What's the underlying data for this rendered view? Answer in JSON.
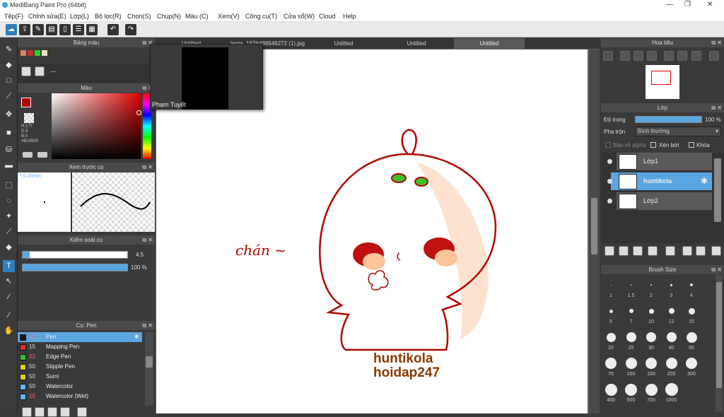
{
  "window": {
    "title": "MediBang Paint Pro (64bit)"
  },
  "menu": [
    "Tệp(F)",
    "Chỉnh sửa(E)",
    "Lớp(L)",
    "Bộ lọc(R)",
    "Chọn(S)",
    "Chụp(N)",
    "Màu (C)",
    "Xem(V)",
    "Công cụ(T)",
    "Cửa sổ(W)",
    "Cloud",
    "Help"
  ],
  "tabs": [
    {
      "label": "Untitled"
    },
    {
      "label": "large_1626488646272 (1).jpg"
    },
    {
      "label": "Untitled"
    },
    {
      "label": "Untitled"
    },
    {
      "label": "Untitled"
    }
  ],
  "popup": {
    "name": "Phạm Tuyết"
  },
  "panels": {
    "palette": {
      "title": "Bảng màu",
      "value": "---"
    },
    "color": {
      "title": "Màu",
      "r": "R:177",
      "g": "G:5",
      "b": "B:0",
      "hex": "#B10500",
      "accent": "#B10500"
    },
    "brush_preview": {
      "title": "Xem trước cọ",
      "size": "0.33mm"
    },
    "brush_control": {
      "title": "Kiểm soát cọ",
      "size": "4.5",
      "opacity": "100 %",
      "opacity_value": 100
    },
    "brushes": {
      "title": "Cọ: Pen",
      "items": [
        {
          "size": "4.5",
          "name": "Pen",
          "color": "#1a1a1a",
          "selected": true
        },
        {
          "size": "15",
          "name": "Mapping Pen",
          "color": "#e03030"
        },
        {
          "size": "22",
          "name": "Edge Pen",
          "color": "#30c030"
        },
        {
          "size": "50",
          "name": "Stipple Pen",
          "color": "#e0d020"
        },
        {
          "size": "50",
          "name": "Sumi",
          "color": "#e0d020"
        },
        {
          "size": "50",
          "name": "Watercolor",
          "color": "#60b8f0"
        },
        {
          "size": "15",
          "name": "Watercolor (Wet)",
          "color": "#60b8f0"
        }
      ]
    },
    "navigator": {
      "title": "Hoa tiêu"
    },
    "layer": {
      "title": "Lớp",
      "opacity_label": "Độ trong",
      "opacity": "100 %",
      "opacity_value": 100,
      "blend_label": "Pha trộn",
      "blend_value": "Bình thường",
      "protect_alpha": "Bảo vệ alpha",
      "clipping": "Xén bớt",
      "lock": "Khóa",
      "layers": [
        {
          "name": "Lớp1",
          "selected": false
        },
        {
          "name": "huntikola",
          "selected": true
        },
        {
          "name": "Lớp2",
          "selected": false
        }
      ]
    },
    "brush_size": {
      "title": "Brush Size",
      "sizes": [
        "1",
        "1.5",
        "2",
        "3",
        "4",
        "5",
        "7",
        "10",
        "12",
        "15",
        "20",
        "25",
        "30",
        "40",
        "50",
        "70",
        "100",
        "150",
        "200",
        "300",
        "400",
        "500",
        "700",
        "1000"
      ]
    }
  },
  "canvas": {
    "text_left": "chán ~",
    "text_line1": "huntikola",
    "text_line2": "hoidap247",
    "line_color": "#B10500",
    "label_color": "#8a3a00"
  }
}
